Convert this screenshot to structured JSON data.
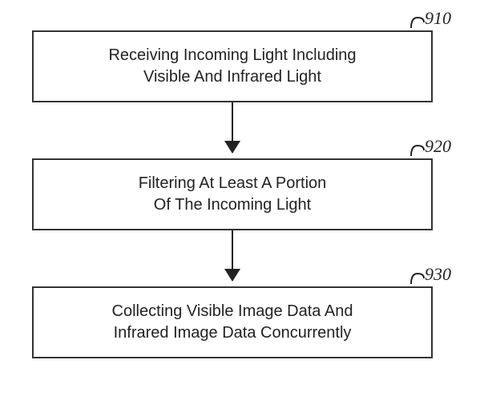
{
  "diagram": {
    "steps": [
      {
        "ref": "910",
        "line1": "Receiving Incoming Light Including",
        "line2": "Visible And Infrared Light"
      },
      {
        "ref": "920",
        "line1": "Filtering At Least A Portion",
        "line2": "Of The Incoming Light"
      },
      {
        "ref": "930",
        "line1": "Collecting Visible Image Data And",
        "line2": "Infrared Image Data Concurrently"
      }
    ]
  }
}
